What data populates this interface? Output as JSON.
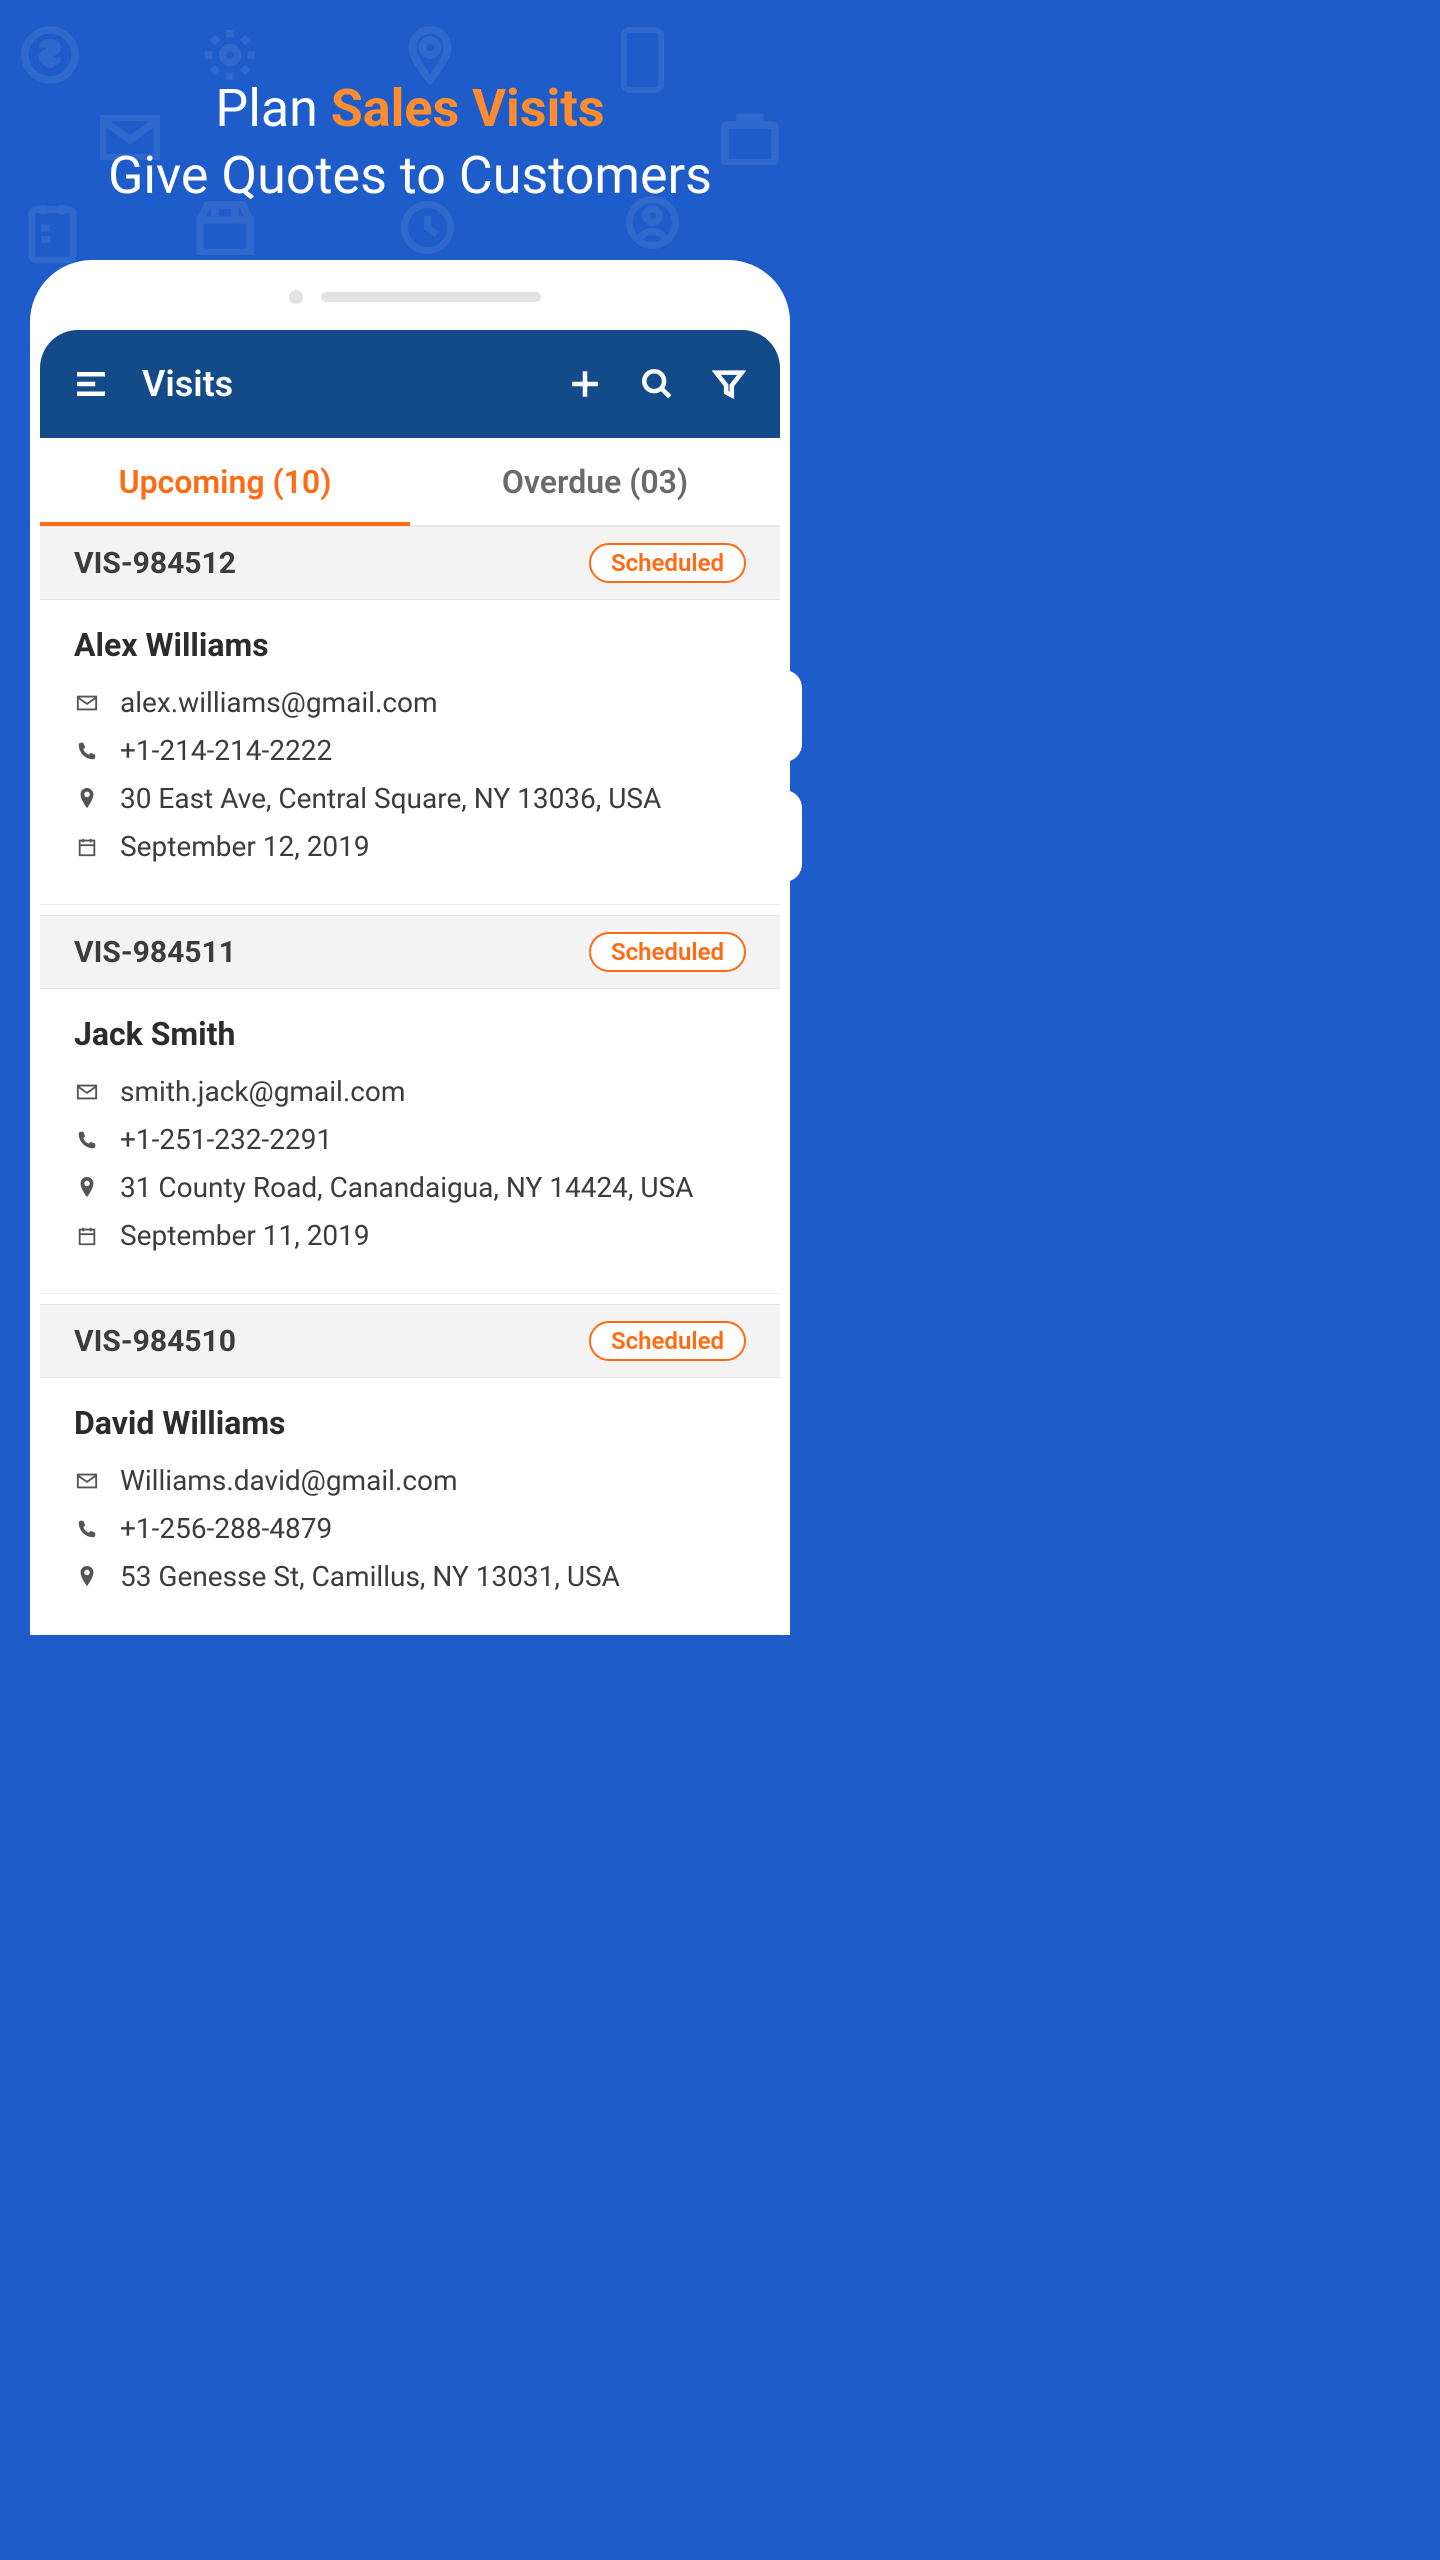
{
  "headline": {
    "plan": "Plan",
    "sales_visits": "Sales Visits",
    "line2": "Give Quotes to Customers"
  },
  "header": {
    "title": "Visits"
  },
  "tabs": {
    "upcoming": "Upcoming (10)",
    "overdue": "Overdue (03)"
  },
  "visits": [
    {
      "id": "VIS-984512",
      "status": "Scheduled",
      "name": "Alex Williams",
      "email": "alex.williams@gmail.com",
      "phone": "+1-214-214-2222",
      "address": "30 East Ave, Central Square, NY 13036, USA",
      "date": "September 12, 2019"
    },
    {
      "id": "VIS-984511",
      "status": "Scheduled",
      "name": "Jack Smith",
      "email": "smith.jack@gmail.com",
      "phone": "+1-251-232-2291",
      "address": "31 County Road, Canandaigua, NY 14424, USA",
      "date": "September 11, 2019"
    },
    {
      "id": "VIS-984510",
      "status": "Scheduled",
      "name": "David Williams",
      "email": "Williams.david@gmail.com",
      "phone": "+1-256-288-4879",
      "address": "53 Genesse St, Camillus, NY 13031, USA",
      "date": ""
    }
  ]
}
